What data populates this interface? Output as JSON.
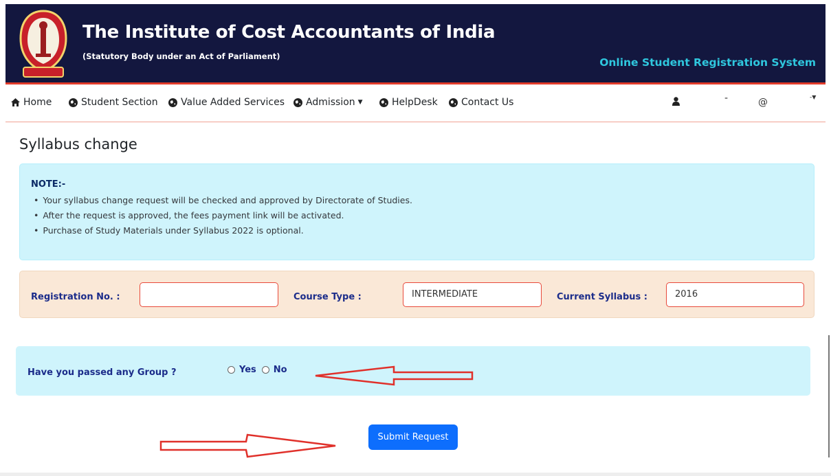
{
  "header": {
    "title": "The Institute of Cost Accountants of India",
    "subtitle": "(Statutory Body under an Act of Parliament)",
    "system_name": "Online Student Registration System",
    "logo_icon": "institute-seal-icon",
    "colors": {
      "background": "#13173f",
      "accent_line": "#e23b2a",
      "system_name": "#2fc7de"
    }
  },
  "nav": {
    "items": [
      {
        "label": "Home",
        "icon": "home-icon"
      },
      {
        "label": "Student Section",
        "icon": "globe-icon"
      },
      {
        "label": "Value Added Services",
        "icon": "globe-icon"
      },
      {
        "label": "Admission",
        "icon": "globe-icon",
        "dropdown": true
      },
      {
        "label": "HelpDesk",
        "icon": "globe-icon"
      },
      {
        "label": "Contact Us",
        "icon": "globe-icon"
      }
    ],
    "user": {
      "icon": "user-icon",
      "dash": "-",
      "at": "@",
      "caret": "-"
    }
  },
  "page": {
    "title": "Syllabus change"
  },
  "note": {
    "heading": "NOTE:-",
    "items": [
      "Your syllabus change request will be checked and approved by Directorate of Studies.",
      "After the request is approved, the fees payment link will be activated.",
      "Purchase of Study Materials under Syllabus 2022 is optional."
    ]
  },
  "registration": {
    "reg_no_label": "Registration No. :",
    "reg_no_value": "",
    "course_type_label": "Course Type :",
    "course_type_value": "INTERMEDIATE",
    "current_syllabus_label": "Current Syllabus :",
    "current_syllabus_value": "2016"
  },
  "group_question": {
    "label": "Have you passed any Group ?",
    "options": [
      "Yes",
      "No"
    ],
    "selected": null
  },
  "submit": {
    "label": "Submit Request"
  },
  "colors": {
    "info_bg": "#cff4fc",
    "form_bg": "#fae8d7",
    "label_blue": "#1b2c8a",
    "button": "#0d6efd",
    "annotation_arrow": "#e0302a"
  }
}
